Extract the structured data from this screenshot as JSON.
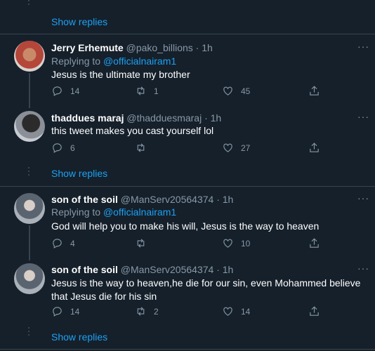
{
  "show_replies_label": "Show replies",
  "more_label": "···",
  "replying_prefix": "Replying to ",
  "tweets": [
    {
      "name": "Jerry Erhemute",
      "handle": "@pako_billions · 1h",
      "replying_to": "@officialnairam1",
      "text": "Jesus is the ultimate my brother",
      "replies": "14",
      "retweets": "1",
      "likes": "45"
    },
    {
      "name": "thaddues maraj",
      "handle": "@thadduesmaraj · 1h",
      "text": "this tweet makes you cast yourself lol",
      "replies": "6",
      "retweets": "",
      "likes": "27"
    },
    {
      "name": "son of the soil",
      "handle": "@ManServ20564374 · 1h",
      "replying_to": "@officialnairam1",
      "text": "God will help you to make his will,  Jesus is the way to heaven",
      "replies": "4",
      "retweets": "",
      "likes": "10"
    },
    {
      "name": "son of the soil",
      "handle": "@ManServ20564374 · 1h",
      "text": "Jesus is the way to heaven,he die for our sin, even Mohammed believe that Jesus die for his sin",
      "replies": "14",
      "retweets": "2",
      "likes": "14"
    }
  ]
}
